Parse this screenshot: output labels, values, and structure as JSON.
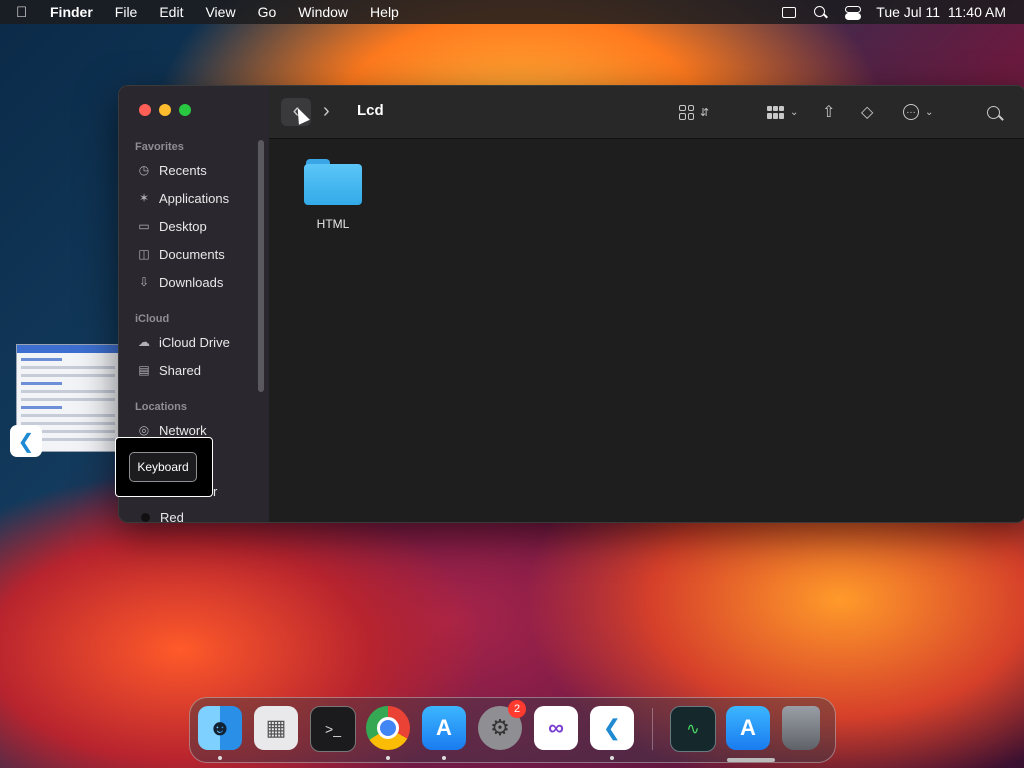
{
  "menubar": {
    "app_name": "Finder",
    "menus": [
      "File",
      "Edit",
      "View",
      "Go",
      "Window",
      "Help"
    ],
    "datetime": "Tue Jul 11  11:40 AM"
  },
  "window": {
    "title": "Lcd",
    "sidebar": {
      "favorites_header": "Favorites",
      "favorites": [
        {
          "label": "Recents",
          "icon": "clock-icon"
        },
        {
          "label": "Applications",
          "icon": "applications-icon"
        },
        {
          "label": "Desktop",
          "icon": "desktop-icon"
        },
        {
          "label": "Documents",
          "icon": "document-icon"
        },
        {
          "label": "Downloads",
          "icon": "download-icon"
        }
      ],
      "icloud_header": "iCloud",
      "icloud": [
        {
          "label": "iCloud Drive",
          "icon": "cloud-icon"
        },
        {
          "label": "Shared",
          "icon": "shared-folder-icon"
        }
      ],
      "locations_header": "Locations",
      "locations": [
        {
          "label": "Network",
          "icon": "globe-icon"
        },
        {
          "label": "r",
          "icon": ""
        }
      ],
      "tags": [
        {
          "label": "Red",
          "color": "#111111"
        }
      ]
    },
    "content": {
      "items": [
        {
          "name": "HTML",
          "type": "folder"
        }
      ]
    }
  },
  "tooltip": {
    "label": "Keyboard"
  },
  "dock": {
    "badge_count": "2",
    "apps": [
      {
        "name": "Finder",
        "icon": "finder-icon"
      },
      {
        "name": "Preview",
        "icon": "preview-icon"
      },
      {
        "name": "Terminal",
        "icon": "terminal-icon"
      },
      {
        "name": "Chrome",
        "icon": "chrome-icon"
      },
      {
        "name": "App Store",
        "icon": "app-store-icon"
      },
      {
        "name": "System Settings",
        "icon": "settings-icon"
      },
      {
        "name": "Visual Studio",
        "icon": "visual-studio-icon"
      },
      {
        "name": "VS Code",
        "icon": "vscode-icon"
      },
      {
        "name": "Activity Monitor",
        "icon": "activity-monitor-icon"
      },
      {
        "name": "App Store 2",
        "icon": "app-store-icon"
      },
      {
        "name": "Trash",
        "icon": "trash-icon"
      }
    ]
  },
  "colors": {
    "menubar_bg": "#1c1c1e",
    "window_bg": "#1e1e1e",
    "folder_blue": "#33aae8",
    "badge_red": "#ff3b30"
  }
}
